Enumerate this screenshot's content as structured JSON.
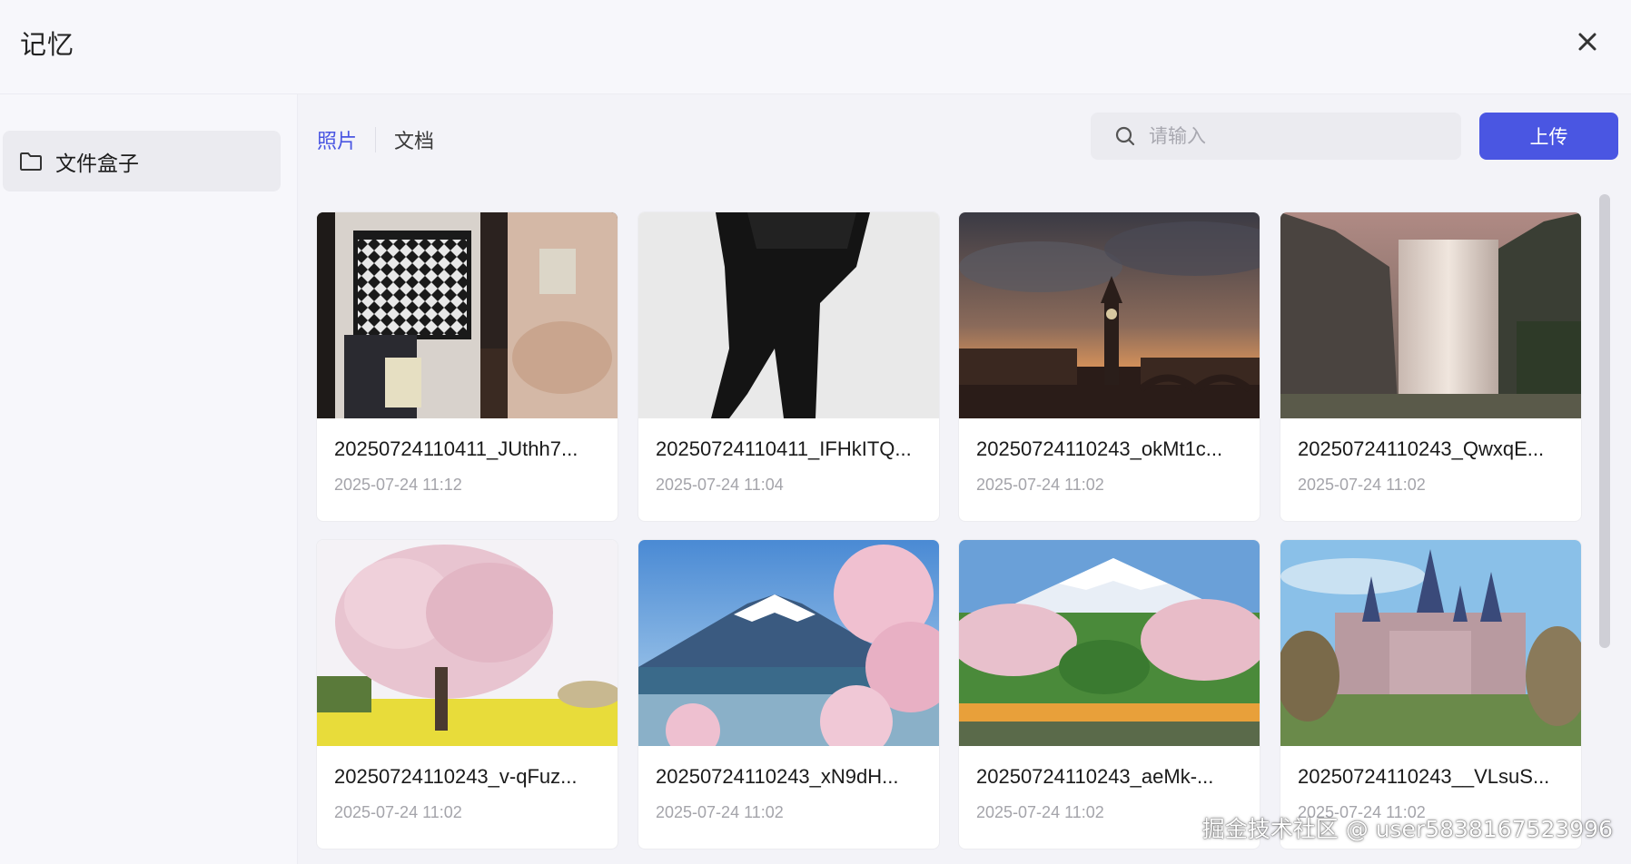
{
  "dialog": {
    "title": "记忆",
    "close_icon": "close-icon"
  },
  "sidebar": {
    "items": [
      {
        "label": "文件盒子",
        "icon": "folder-icon"
      }
    ]
  },
  "tabs": [
    {
      "label": "照片",
      "active": true
    },
    {
      "label": "文档",
      "active": false
    }
  ],
  "search": {
    "placeholder": "请输入",
    "value": "",
    "icon": "search-icon"
  },
  "upload_label": "上传",
  "photos": [
    {
      "name": "20250724110411_JUthh7...",
      "date": "2025-07-24 11:12"
    },
    {
      "name": "20250724110411_IFHkITQ...",
      "date": "2025-07-24 11:04"
    },
    {
      "name": "20250724110243_okMt1c...",
      "date": "2025-07-24 11:02"
    },
    {
      "name": "20250724110243_QwxqE...",
      "date": "2025-07-24 11:02"
    },
    {
      "name": "20250724110243_v-qFuz...",
      "date": "2025-07-24 11:02"
    },
    {
      "name": "20250724110243_xN9dH...",
      "date": "2025-07-24 11:02"
    },
    {
      "name": "20250724110243_aeMk-...",
      "date": "2025-07-24 11:02"
    },
    {
      "name": "20250724110243__VLsuS...",
      "date": "2025-07-24 11:02"
    }
  ],
  "watermark": "掘金技术社区 @ user5838167523996",
  "colors": {
    "accent": "#4a56e2",
    "background": "#f3f3f8"
  }
}
